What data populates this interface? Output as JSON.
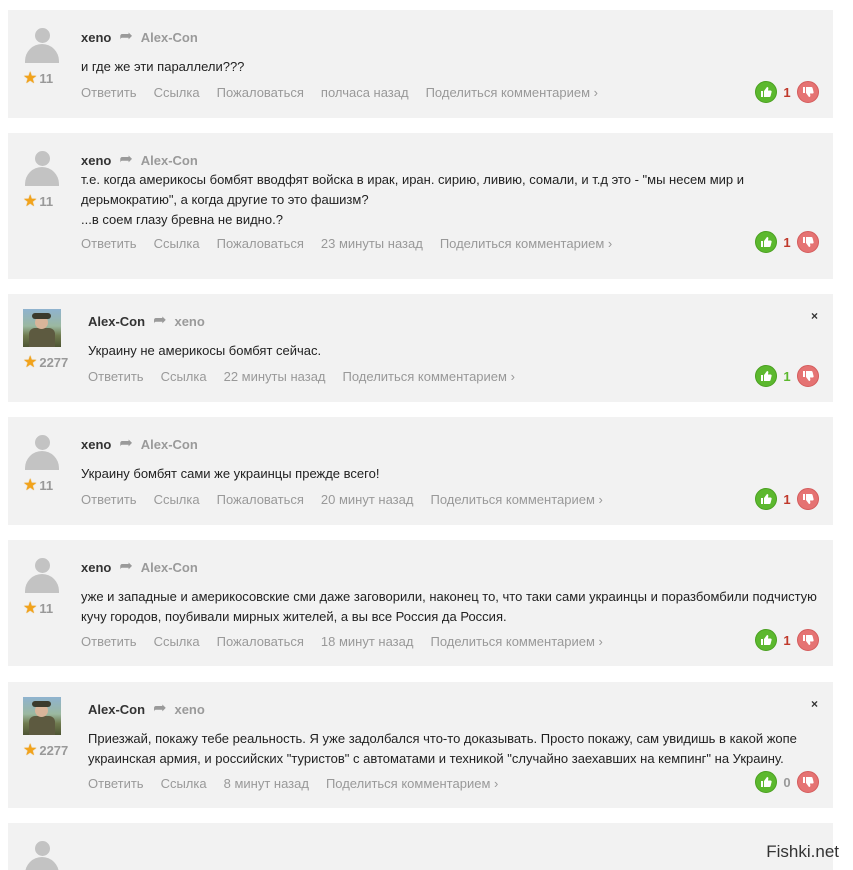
{
  "comments": [
    {
      "author": "xeno",
      "recipient": "Alex-Con",
      "avatar": "default-user-icon",
      "rating": "11",
      "text_lines": [
        "и где же эти параллели???"
      ],
      "actions": [
        "Ответить",
        "Ссылка",
        "Пожаловаться",
        "полчаса назад",
        "Поделиться комментарием ›"
      ],
      "vote_count": "1",
      "vote_color": "#c0392b",
      "closable": false
    },
    {
      "author": "xeno",
      "recipient": "Alex-Con",
      "avatar": "default-user-icon",
      "rating": "11",
      "text_lines": [
        "т.е. когда америкосы бомбят вводфят войска в ирак, иран. сирию, ливию, сомали, и т.д это - \"мы несем мир и",
        "дерьмократию\", а когда другие то это фашизм?",
        "...в соем глазу бревна не видно.?"
      ],
      "actions": [
        "Ответить",
        "Ссылка",
        "Пожаловаться",
        "23 минуты назад",
        "Поделиться комментарием ›"
      ],
      "vote_count": "1",
      "vote_color": "#c0392b",
      "closable": false
    },
    {
      "author": "Alex-Con",
      "recipient": "xeno",
      "avatar": "photo-avatar",
      "rating": "2277",
      "text_lines": [
        "Украину не америкосы бомбят сейчас."
      ],
      "actions": [
        "Ответить",
        "Ссылка",
        "22 минуты назад",
        "Поделиться комментарием ›"
      ],
      "vote_count": "1",
      "vote_color": "#5cb82e",
      "closable": true
    },
    {
      "author": "xeno",
      "recipient": "Alex-Con",
      "avatar": "default-user-icon",
      "rating": "11",
      "text_lines": [
        "Украину бомбят сами же украинцы прежде всего!"
      ],
      "actions": [
        "Ответить",
        "Ссылка",
        "Пожаловаться",
        "20 минут назад",
        "Поделиться комментарием ›"
      ],
      "vote_count": "1",
      "vote_color": "#c0392b",
      "closable": false
    },
    {
      "author": "xeno",
      "recipient": "Alex-Con",
      "avatar": "default-user-icon",
      "rating": "11",
      "text_lines": [
        "уже и западные и америкосовские сми даже заговорили, наконец то, что таки сами украинцы и поразбомбили подчистую",
        "кучу городов, поубивали мирных жителей, а вы все Россия да Россия."
      ],
      "actions": [
        "Ответить",
        "Ссылка",
        "Пожаловаться",
        "18 минут назад",
        "Поделиться комментарием ›"
      ],
      "vote_count": "1",
      "vote_color": "#c0392b",
      "closable": false
    },
    {
      "author": "Alex-Con",
      "recipient": "xeno",
      "avatar": "photo-avatar",
      "rating": "2277",
      "text_lines": [
        "Приезжай, покажу тебе реальность. Я уже задолбался что-то доказывать. Просто покажу, сам увидишь в какой жопе",
        "украинская армия, и российских \"туристов\" с автоматами и техникой \"случайно заехавших на кемпинг\" на Украину."
      ],
      "actions": [
        "Ответить",
        "Ссылка",
        "8 минут назад",
        "Поделиться комментарием ›"
      ],
      "vote_count": "0",
      "vote_color": "#999999",
      "closable": true
    }
  ],
  "close_label": "×",
  "thumb_up_glyph": "👍",
  "thumb_down_glyph": "👎",
  "star_glyph": "★",
  "reply_glyph": "➦",
  "watermark": "Fishki.net"
}
